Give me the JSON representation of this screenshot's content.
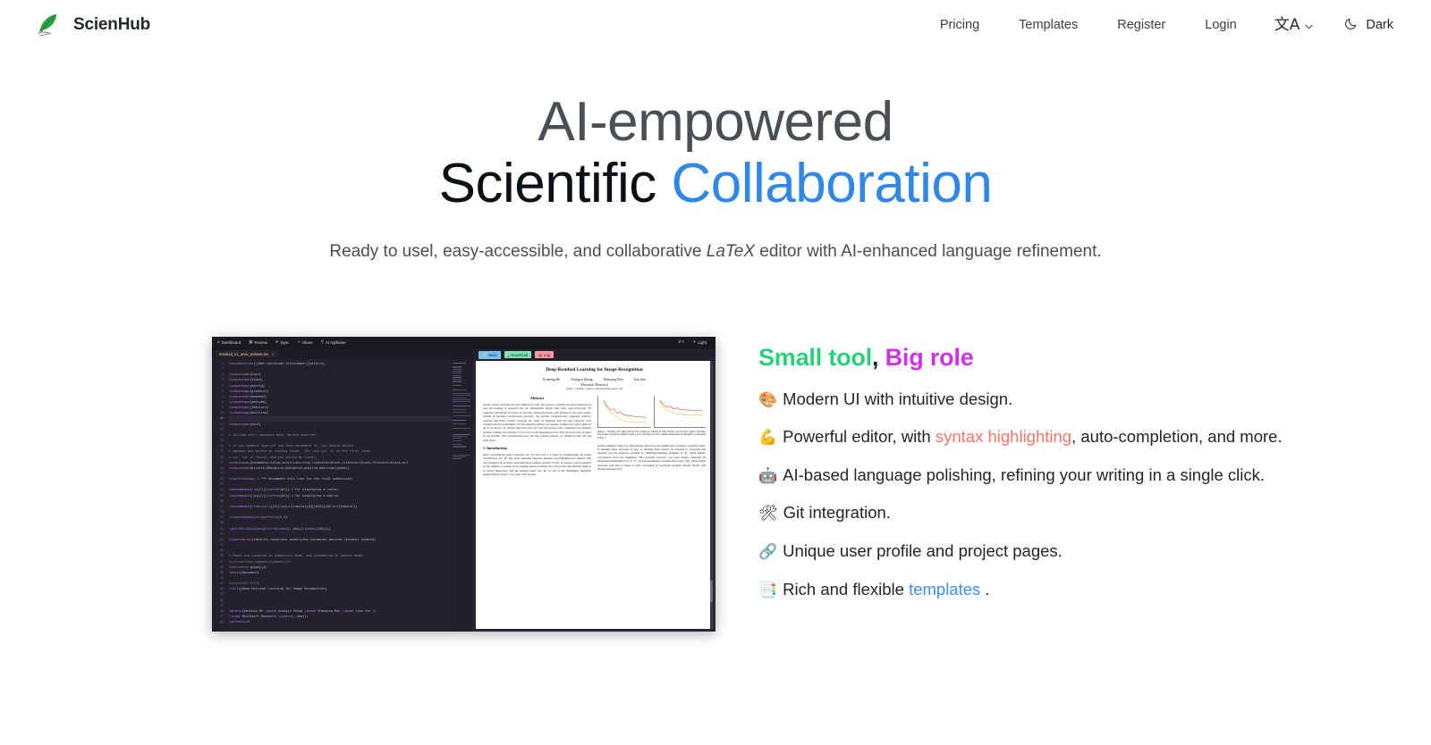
{
  "header": {
    "brand": {
      "name": "ScienHub",
      "logo_icon": "quill-feather-icon"
    },
    "nav": [
      {
        "label": "Pricing",
        "name": "nav-link-pricing"
      },
      {
        "label": "Templates",
        "name": "nav-link-templates"
      },
      {
        "label": "Register",
        "name": "nav-link-register"
      },
      {
        "label": "Login",
        "name": "nav-link-login"
      }
    ],
    "language": {
      "glyph": "文A",
      "icon": "translate-icon",
      "chevron_icon": "chevron-down-icon"
    },
    "theme": {
      "label": "Dark",
      "icon": "moon-icon"
    }
  },
  "hero": {
    "line1": "AI-empowered",
    "line2_a": "Scientific ",
    "line2_b": "Collaboration",
    "subtitle_1": "Ready to usel, easy-accessible, and collaborative ",
    "subtitle_latex": "LaTeX",
    "subtitle_2": " editor with AI-enhanced language refinement."
  },
  "features": {
    "title_a": "Small tool",
    "title_comma": ", ",
    "title_b": "Big role",
    "items": [
      {
        "emoji": "🎨",
        "icon": "palette-emoji",
        "text_1": "Modern UI with intuitive design.",
        "link": "",
        "text_2": ""
      },
      {
        "emoji": "💪",
        "icon": "flexed-biceps-emoji",
        "text_1": "Powerful editor, with ",
        "link": "syntax highlighting",
        "link_color": "coral",
        "text_2": ", auto-completion, and more."
      },
      {
        "emoji": "🤖",
        "icon": "robot-emoji",
        "text_1": "AI-based language polishing, refining your writing in a single click.",
        "link": "",
        "text_2": ""
      },
      {
        "emoji": "🛠",
        "icon": "hammer-and-wrench-emoji",
        "text_1": "Git integration.",
        "link": "",
        "text_2": ""
      },
      {
        "emoji": "🔗",
        "icon": "link-emoji",
        "text_1": "Unique user profile and project pages.",
        "link": "",
        "text_2": ""
      },
      {
        "emoji": "📑",
        "icon": "bookmark-tabs-emoji",
        "text_1": "Rich and flexible ",
        "link": "templates",
        "link_color": "blue",
        "text_2": " ."
      }
    ]
  },
  "screenshot": {
    "name": "scienhub-editor-screenshot",
    "toolbar": [
      {
        "icon": "home-icon",
        "glyph": "⌂",
        "label": "Dashboard"
      },
      {
        "icon": "review-icon",
        "glyph": "▦",
        "label": "Review"
      },
      {
        "icon": "sync-icon",
        "glyph": "⟳",
        "label": "Sync"
      },
      {
        "icon": "share-icon",
        "glyph": "≺",
        "label": "Share"
      },
      {
        "icon": "ai-rephrase-icon",
        "glyph": "⚲",
        "label": "AI rephrase"
      }
    ],
    "toolbar_right": [
      {
        "icon": "collapse-icon",
        "glyph": "⇵⇳",
        "label": ""
      },
      {
        "icon": "sun-icon",
        "glyph": "☀",
        "label": "Light"
      }
    ],
    "tab": {
      "filename": "residual_v1_arxiv_release.tex",
      "close_icon": "close-icon"
    },
    "pdf_actions": [
      {
        "label": "Build",
        "icon": "build-icon",
        "glyph": "⚡",
        "color": "#79c0f5"
      },
      {
        "label": "Download",
        "icon": "download-icon",
        "glyph": "⤓",
        "color": "#86e3b6"
      },
      {
        "label": "Log",
        "icon": "log-icon",
        "glyph": "▤",
        "color": "#f79aa0"
      }
    ],
    "code": {
      "first_line_number": 1,
      "lines": [
        "\\documentclass[10pt,twocolumn,letterpaper]{article}",
        "",
        "\\usepackage{cvpr}",
        "\\usepackage{times}",
        "\\usepackage{epsfig}",
        "\\usepackage{graphicx}",
        "\\usepackage{amsmath}",
        "\\usepackage{amssymb}",
        "\\usepackage{tabulary}",
        "\\usepackage{multirow}",
        "",
        "\\usepackage{soul}",
        "",
        "% include other packages here, before hyperref.",
        "",
        "% if you comment hyperref and then uncomment it, you should delete",
        "% egpaper.aux before re-running latex.  (Or just hit 'q' on the first latex",
        "% run, let it finish, and you should be clear).",
        "\\usepackage[bookmarks=false,colorlinks=true,linkcolor=black,citecolor=black,filecolor=black,url",
        "\\usepackage[british,UKenglish,USenglish,english,american]{babel}",
        "",
        "\\cvprfinalcopy % *** Uncomment this line for the final submission",
        "",
        "\\newcommand{\\ve}[1]{\\mathbf{#1}} % for displaying a vector",
        "\\newcommand{\\ma}[1]{\\mathrm{#1}} % for displaying a matrix",
        "",
        "\\newcommand{\\tabincell}[2]{\\begin{tabular}{@{}#1@{}}#2\\end{tabular}}",
        "",
        "\\renewcommand\\arraystretch{1.2}",
        "",
        "\\def\\httilde{\\mbox{\\tt\\raisebox{-.5ex}{\\symbol{126}}}}",
        "",
        "\\hyphenation{identity notorious underlying surpasses desired residual doubled}",
        "",
        "",
        "% Pages are numbered in submission mode, and unnumbered in camera-ready",
        "%\\ifcvprfinal\\pagestyle{empty}\\fi",
        "\\setcounter{page}{1}",
        "\\begin{document}",
        "",
        "%%%%%%%%%% TITLE",
        "\\title{Deep Residual Learning for Image Recognition}",
        "",
        "",
        "",
        "\\author{Kaiming He \\qquad Xiangyu Zhang \\qquad Shaoqing Ren \\qquad Jian Sun \\\\",
        "\\large Microsoft Research \\vspace{-.4em}\\\\",
        "\\normalsize"
      ],
      "caret_line_index": 10
    },
    "pdf": {
      "title": "Deep Residual Learning for Image Recognition",
      "authors": [
        "Kaiming He",
        "Xiangyu Zhang",
        "Shaoqing Ren",
        "Jian Sun"
      ],
      "affiliation": "Microsoft Research",
      "email": "{kahe, v-xiangz, v-shren, jiansun}@microsoft.com",
      "abstract_heading": "Abstract",
      "abstract_text": "Deeper neural networks are more difficult to train. We present a residual learning framework to ease the training of networks that are substantially deeper than those used previously. We explicitly reformulate the layers as learning residual functions with reference to the layer inputs, instead of learning unreferenced functions. We provide comprehensive empirical evidence showing that these residual networks are easier to optimize, and can gain accuracy from considerably increased depth. On the ImageNet dataset we evaluate residual nets with a depth of up to 152 layers—8× deeper than VGG nets [41] but still having lower complexity. An ensemble of these residual nets achieves 3.57% error on the ImageNet test set. This result won the 1st place on the ILSVRC 2015 classification task. We also present analysis on CIFAR-10 with 100 and 1000 layers.",
      "figure_caption": "Figure 1. Training error (left) and test error (right) on CIFAR-10 with 20-layer and 56-layer \"plain\" networks. The deeper network has higher training error, and thus test error. Similar phenomena on ImageNet is presented in Fig. 4.",
      "section_heading": "1. Introduction",
      "section_text": "Deep convolutional neural networks [22, 21] have led to a series of breakthroughs for image classification [21, 50, 40]. Deep networks naturally integrate low/mid/high-level features [50] and classifiers in an end-to-end multi-layer fashion, and the \"levels\" of features can be enriched by the number of stacked layers (depth). Recent evidence [41, 44] reveals that network depth is of crucial importance, and the leading results [41, 44, 13, 16] on the challenging ImageNet dataset [36] all exploit \"very deep\" [41] models.",
      "right_col_text": "greatly benefited from very deep models.\n    Driven by the significance of depth, a question arises: Is learning better networks as easy as stacking more layers? An obstacle to answering this question was the notorious problem of vanishing/exploding gradients [1, 9], which hamper convergence from the beginning. This problem, however, has been largely addressed by normalized initialization [23, 9, 37, 13] and intermediate normalization layers [16], which enable networks with tens of layers to start converging for stochastic gradient descent (SGD) with backpropagation [22].",
      "figures": [
        {
          "ylabel": "training error (%)",
          "xlabel": "iter. (1e4)",
          "series": [
            "20-layer",
            "56-layer"
          ]
        },
        {
          "ylabel": "test error (%)",
          "xlabel": "iter. (1e4)",
          "series": [
            "20-layer",
            "56-layer"
          ]
        }
      ]
    }
  },
  "colors": {
    "accent_blue": "#2f88e8",
    "green": "#27d07a",
    "magenta": "#d130e8",
    "coral": "#f4766a",
    "link_blue": "#3a8ff0",
    "text_dark": "#1f2328"
  }
}
